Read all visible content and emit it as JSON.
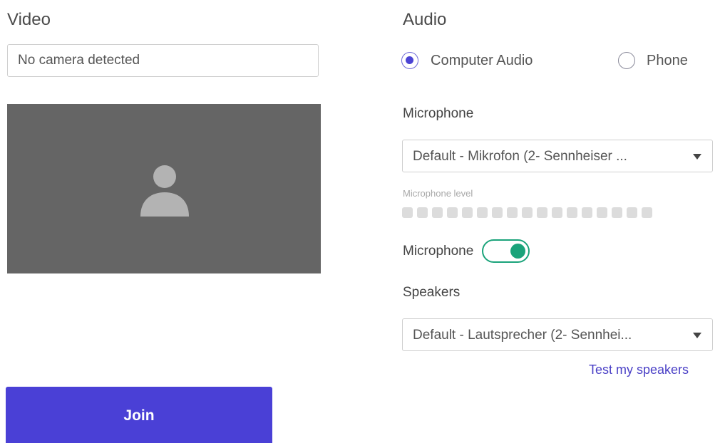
{
  "video": {
    "title": "Video",
    "camera_status": "No camera detected"
  },
  "audio": {
    "title": "Audio",
    "options": [
      {
        "label": "Computer Audio",
        "selected": true
      },
      {
        "label": "Phone",
        "selected": false
      }
    ],
    "microphone": {
      "label": "Microphone",
      "selected": "Default - Mikrofon (2- Sennheiser ...",
      "level_label": "Microphone level",
      "level_segments": 17,
      "level": 0,
      "toggle_label": "Microphone",
      "toggle_on": true
    },
    "speakers": {
      "label": "Speakers",
      "selected": "Default - Lautsprecher (2- Sennhei...",
      "test_link": "Test my speakers"
    }
  },
  "actions": {
    "join_label": "Join"
  },
  "colors": {
    "accent": "#4a40d6",
    "toggle_on": "#1aa37a",
    "preview_bg": "#656565"
  }
}
